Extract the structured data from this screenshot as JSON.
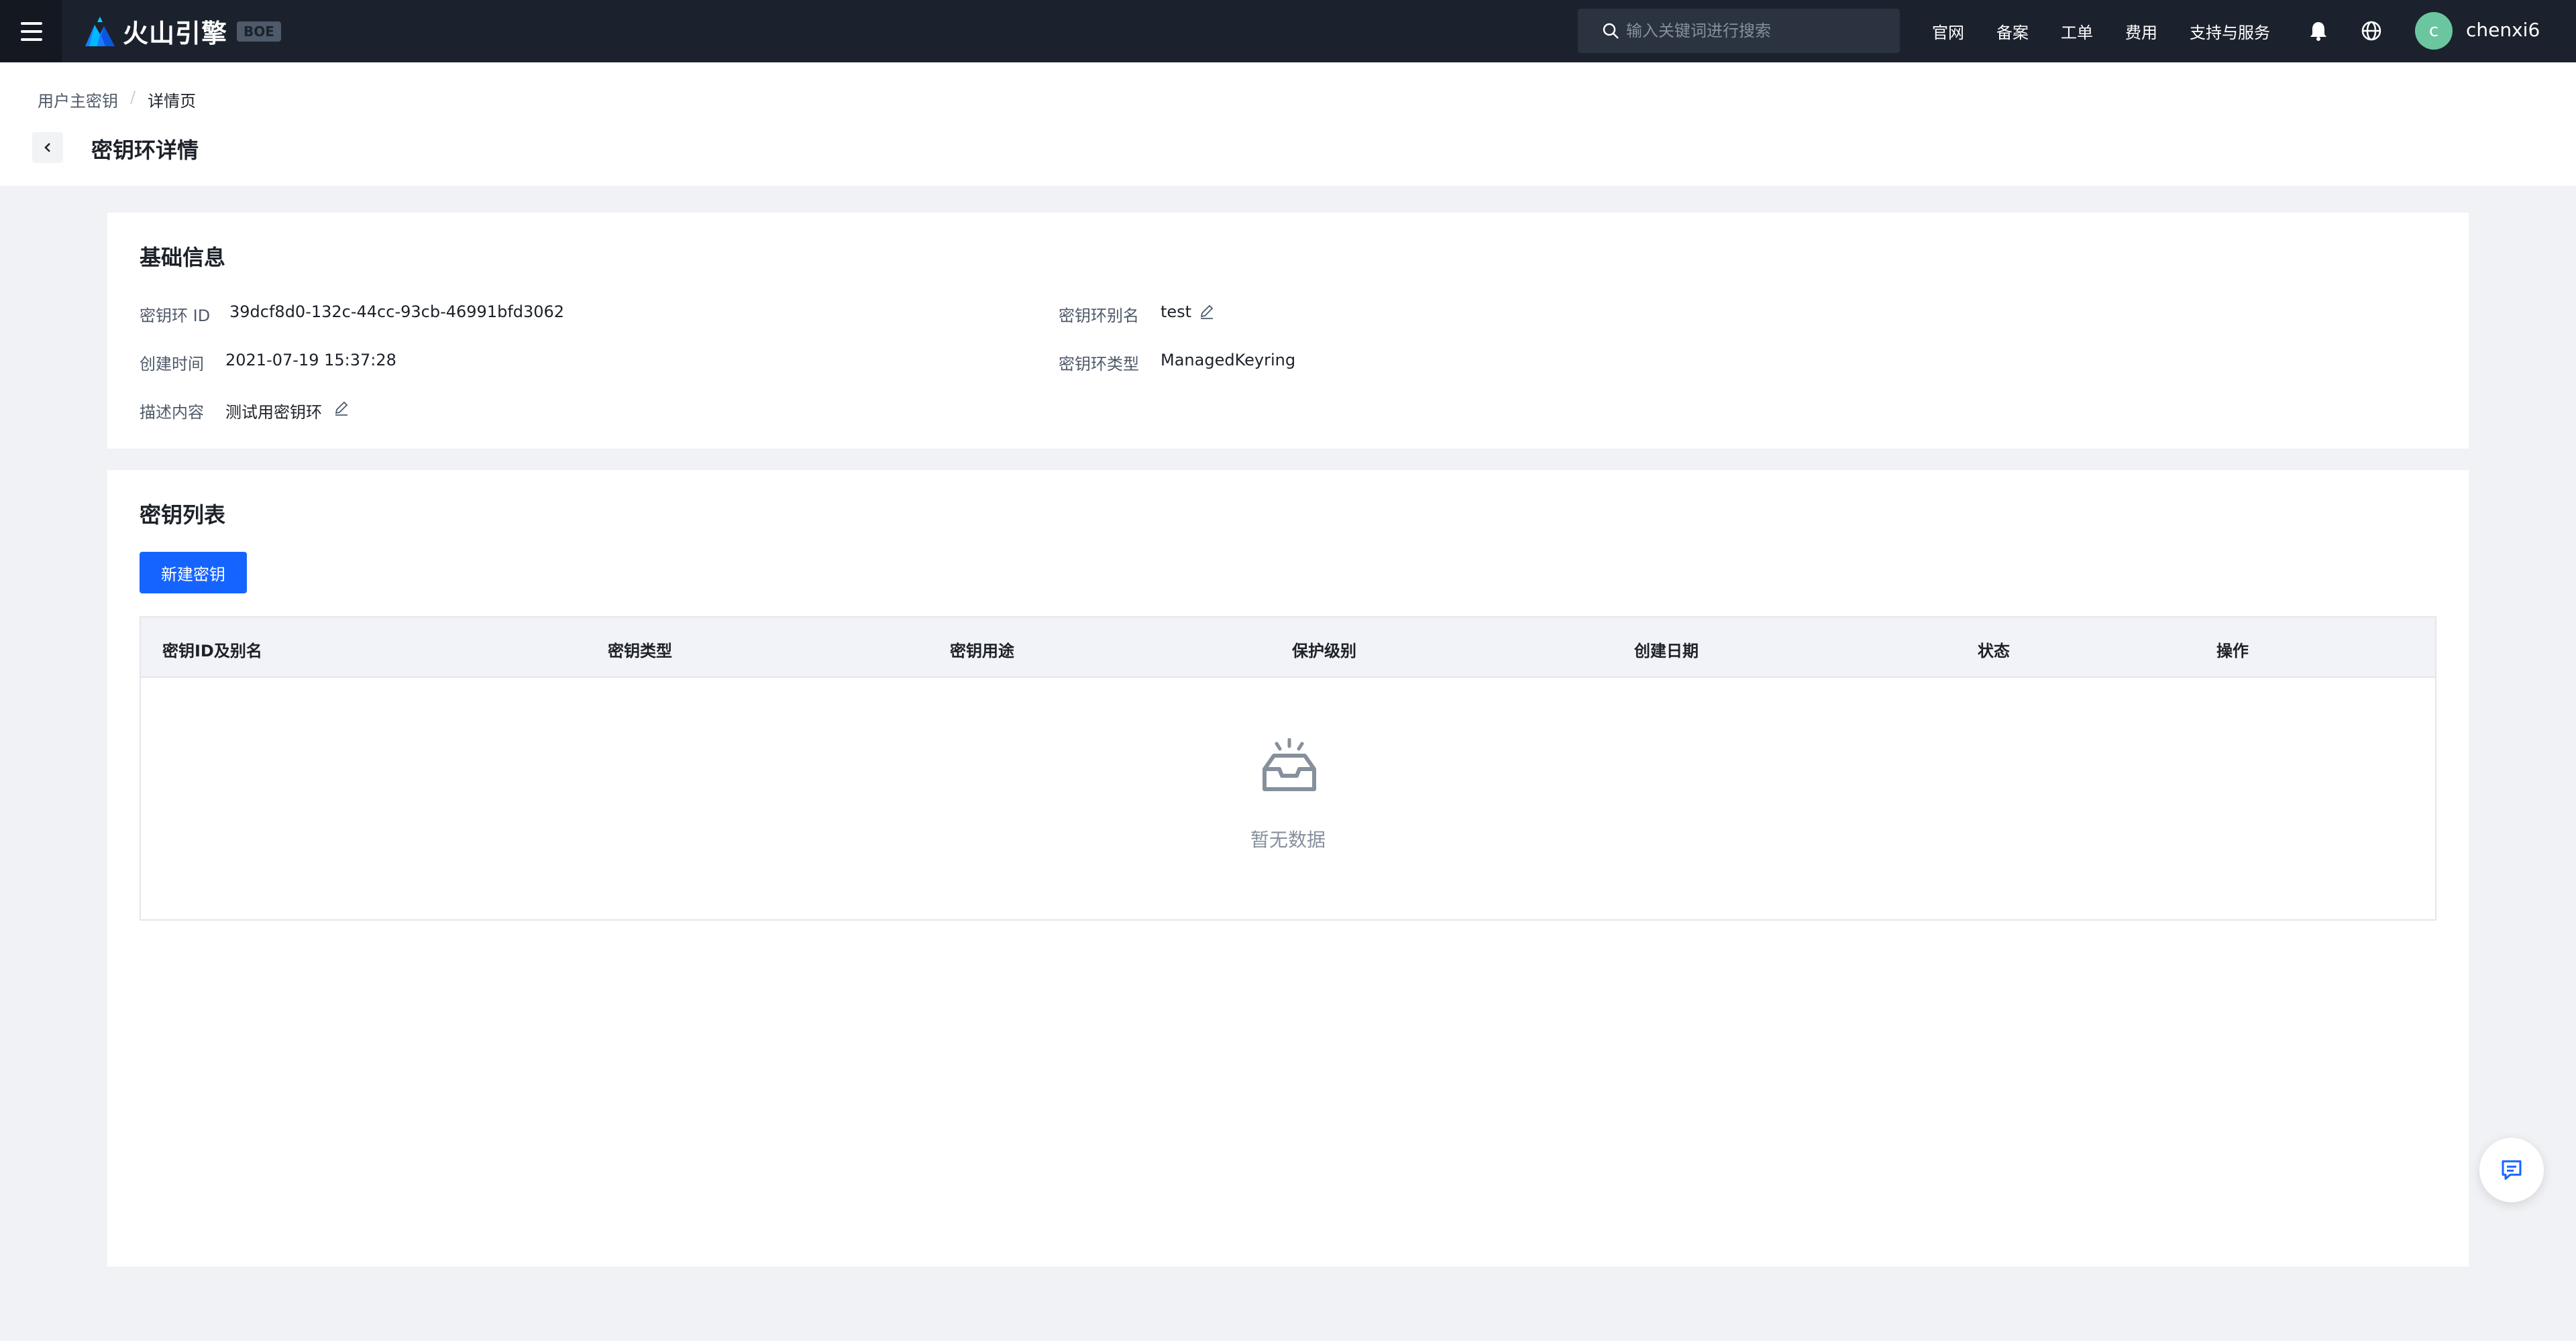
{
  "topbar": {
    "brand": "火山引擎",
    "env_badge": "BOE",
    "search_placeholder": "输入关键词进行搜索",
    "links": [
      "官网",
      "备案",
      "工单",
      "费用",
      "支持与服务"
    ],
    "avatar_initial": "c",
    "username": "chenxi6"
  },
  "breadcrumb": {
    "parent": "用户主密钥",
    "separator": "/",
    "current": "详情页"
  },
  "page_title": "密钥环详情",
  "basic_info": {
    "title": "基础信息",
    "fields": {
      "keyring_id_label": "密钥环 ID",
      "keyring_id_value": "39dcf8d0-132c-44cc-93cb-46991bfd3062",
      "alias_label": "密钥环别名",
      "alias_value": "test",
      "created_label": "创建时间",
      "created_value": "2021-07-19 15:37:28",
      "type_label": "密钥环类型",
      "type_value": "ManagedKeyring",
      "desc_label": "描述内容",
      "desc_value": "测试用密钥环"
    }
  },
  "key_list": {
    "title": "密钥列表",
    "create_button": "新建密钥",
    "columns": [
      "密钥ID及别名",
      "密钥类型",
      "密钥用途",
      "保护级别",
      "创建日期",
      "状态",
      "操作"
    ],
    "rows": [],
    "empty_text": "暂无数据"
  },
  "colors": {
    "primary": "#1664ff",
    "topbar_bg": "#1c222d",
    "page_bg": "#f1f2f5"
  }
}
